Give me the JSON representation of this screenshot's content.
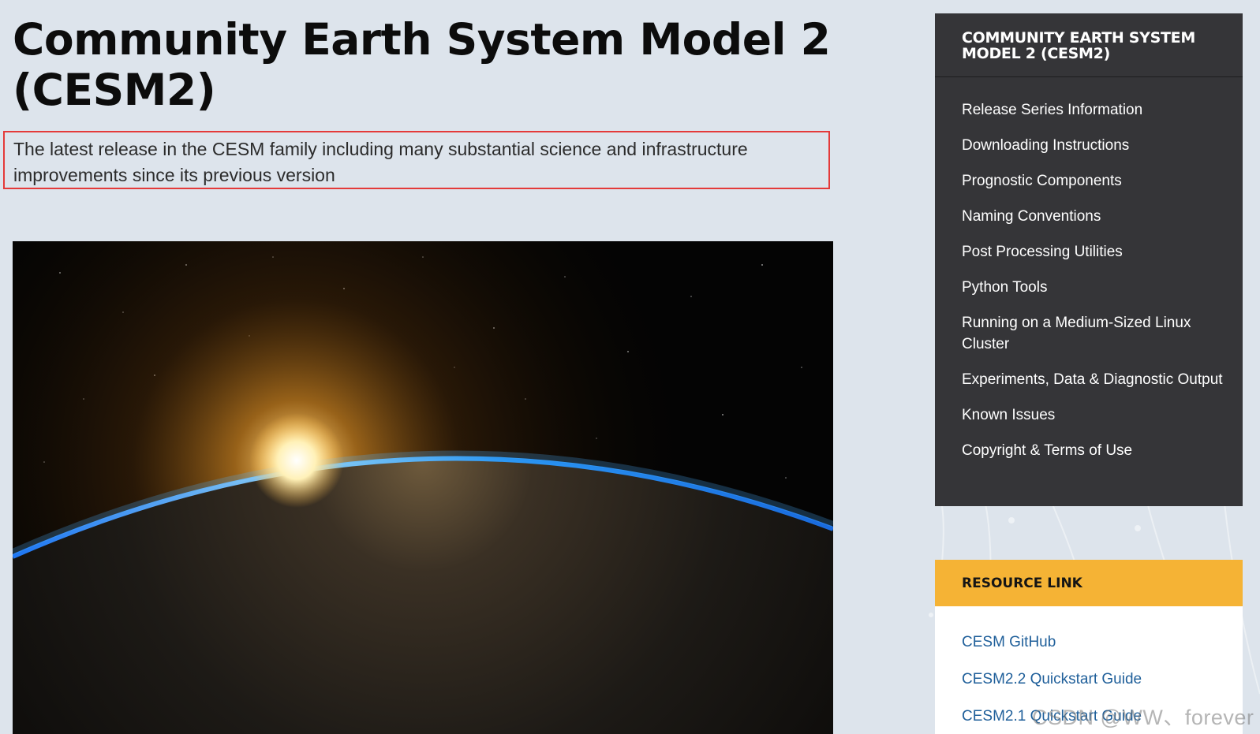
{
  "header": {
    "title": "Community Earth System Model 2 (CESM2)",
    "subtitle": "The latest release in the CESM family including many substantial science and infrastructure improvements since its previous version"
  },
  "sidebar": {
    "title": "COMMUNITY EARTH SYSTEM MODEL 2 (CESM2)",
    "items": [
      {
        "label": "Release Series Information"
      },
      {
        "label": "Downloading Instructions"
      },
      {
        "label": "Prognostic Components"
      },
      {
        "label": "Naming Conventions"
      },
      {
        "label": "Post Processing Utilities"
      },
      {
        "label": "Python Tools"
      },
      {
        "label": "Running on a Medium-Sized Linux Cluster"
      },
      {
        "label": "Experiments, Data & Diagnostic Output"
      },
      {
        "label": "Known Issues"
      },
      {
        "label": "Copyright & Terms of Use"
      }
    ]
  },
  "resources": {
    "title": "RESOURCE LINK",
    "links": [
      {
        "label": "CESM GitHub"
      },
      {
        "label": "CESM2.2 Quickstart Guide"
      },
      {
        "label": "CESM2.1 Quickstart Guide"
      }
    ]
  },
  "watermark": "CSDN @WW、forever",
  "colors": {
    "page_background": "#dde4ec",
    "sidebar_background": "#353538",
    "resource_header": "#f5b335",
    "link": "#1f5f9a",
    "highlight_border": "#e43a3a"
  }
}
